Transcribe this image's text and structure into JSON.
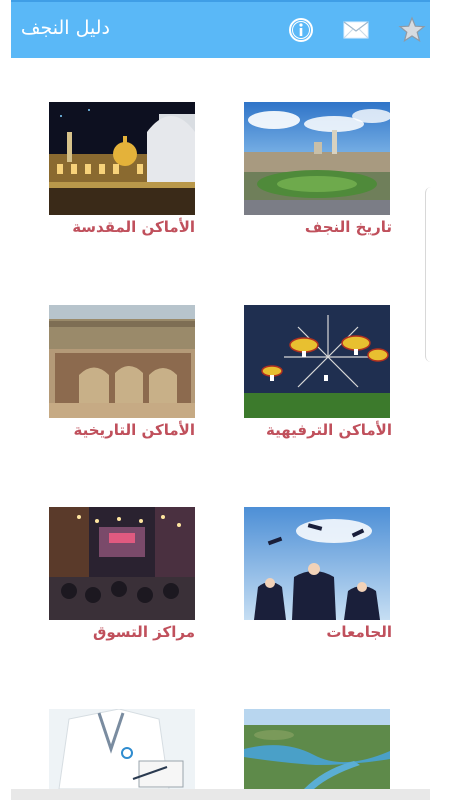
{
  "app": {
    "title": "دليل النجف",
    "icons": [
      "star-icon",
      "mail-icon",
      "info-icon"
    ],
    "bar_color": "#5ab8f7"
  },
  "grid": {
    "label_color": "#c0505c",
    "items": [
      {
        "label": "تاريخ النجف",
        "image": "city-panorama"
      },
      {
        "label": "الأماكن المقدسة",
        "image": "shrine-night"
      },
      {
        "label": "الأماكن الترفيهية",
        "image": "ferris-wheel"
      },
      {
        "label": "الأماكن التاريخية",
        "image": "ruins"
      },
      {
        "label": "الجامعات",
        "image": "graduation"
      },
      {
        "label": "مراكز التسوق",
        "image": "market"
      },
      {
        "label": "",
        "image": "river-aerial"
      },
      {
        "label": "",
        "image": "doctor"
      }
    ]
  }
}
